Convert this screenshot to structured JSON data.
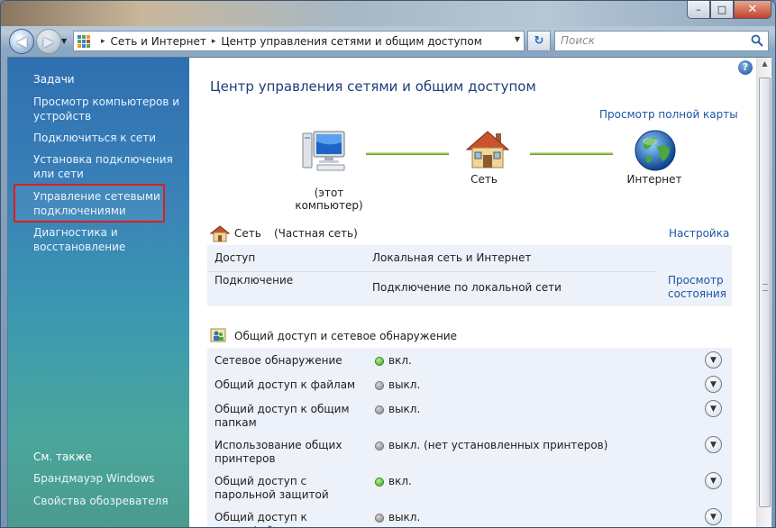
{
  "window": {
    "buttons": {
      "minimize": "–",
      "maximize": "□",
      "close": "✕"
    }
  },
  "navigation": {
    "back_icon": "back-arrow-icon",
    "forward_icon": "forward-arrow-icon",
    "address": {
      "crumbs": [
        "Сеть и Интернет",
        "Центр управления сетями и общим доступом"
      ],
      "separator": "▸"
    },
    "search": {
      "placeholder": "Поиск"
    }
  },
  "sidebar": {
    "tasks_heading": "Задачи",
    "tasks": [
      "Просмотр компьютеров и устройств",
      "Подключиться к сети",
      "Установка подключения или сети",
      "Управление сетевыми подключениями",
      "Диагностика и восстановление"
    ],
    "highlighted_index": 3,
    "see_also_heading": "См. также",
    "see_also": [
      "Брандмауэр Windows",
      "Свойства обозревателя"
    ]
  },
  "main": {
    "help": "?",
    "title": "Центр управления сетями и общим доступом",
    "full_map_link": "Просмотр полной карты",
    "map": {
      "computer": "(этот компьютер)",
      "network": "Сеть",
      "internet": "Интернет"
    },
    "network": {
      "name": "Сеть",
      "type": "(Частная сеть)",
      "configure_link": "Настройка",
      "rows": [
        {
          "label": "Доступ",
          "value": "Локальная сеть и Интернет"
        },
        {
          "label": "Подключение",
          "value": "Подключение по локальной сети"
        }
      ],
      "view_status_link": "Просмотр состояния"
    },
    "sharing": {
      "heading": "Общий доступ и сетевое обнаружение",
      "rows": [
        {
          "label": "Сетевое обнаружение",
          "status": "on",
          "state": "вкл."
        },
        {
          "label": "Общий доступ к файлам",
          "status": "off",
          "state": "выкл."
        },
        {
          "label": "Общий доступ к общим папкам",
          "status": "off",
          "state": "выкл."
        },
        {
          "label": "Использование общих принтеров",
          "status": "off",
          "state": "выкл. (нет установленных принтеров)"
        },
        {
          "label": "Общий доступ с парольной защитой",
          "status": "on",
          "state": "вкл."
        },
        {
          "label": "Общий доступ к медиафайлам",
          "status": "off",
          "state": "выкл."
        }
      ]
    }
  },
  "colors": {
    "link": "#1c56a6",
    "title": "#1e3c78",
    "highlight_border": "#dd1d1d",
    "status_on": "#2f9a1a",
    "status_off": "#7a7a7a"
  }
}
